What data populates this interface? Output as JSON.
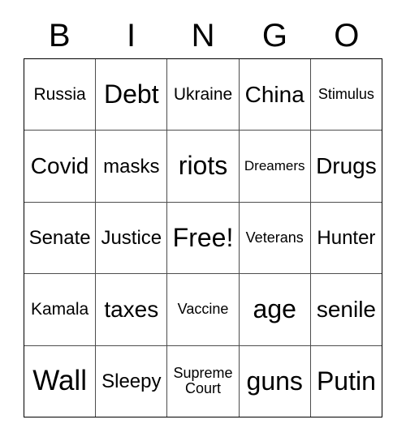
{
  "card": {
    "title": "BINGO",
    "header_letters": [
      "B",
      "I",
      "N",
      "G",
      "O"
    ],
    "colors": {
      "background": "#ffffff",
      "text": "#000000",
      "outer_border": "#000000",
      "inner_border": "#4d4d4d"
    },
    "rows": [
      [
        {
          "label": "Russia",
          "size": "md"
        },
        {
          "label": "Debt",
          "size": "xxl"
        },
        {
          "label": "Ukraine",
          "size": "md"
        },
        {
          "label": "China",
          "size": "xl"
        },
        {
          "label": "Stimulus",
          "size": "sm"
        }
      ],
      [
        {
          "label": "Covid",
          "size": "xl"
        },
        {
          "label": "masks",
          "size": "lg"
        },
        {
          "label": "riots",
          "size": "xxl"
        },
        {
          "label": "Dreamers",
          "size": "xs"
        },
        {
          "label": "Drugs",
          "size": "xl"
        }
      ],
      [
        {
          "label": "Senate",
          "size": "lg"
        },
        {
          "label": "Justice",
          "size": "lg"
        },
        {
          "label": "Free!",
          "size": "xxl"
        },
        {
          "label": "Veterans",
          "size": "sm"
        },
        {
          "label": "Hunter",
          "size": "lg"
        }
      ],
      [
        {
          "label": "Kamala",
          "size": "md"
        },
        {
          "label": "taxes",
          "size": "xl"
        },
        {
          "label": "Vaccine",
          "size": "sm"
        },
        {
          "label": "age",
          "size": "xxl"
        },
        {
          "label": "senile",
          "size": "xl"
        }
      ],
      [
        {
          "label": "Wall",
          "size": "xxxl"
        },
        {
          "label": "Sleepy",
          "size": "lg"
        },
        {
          "label": "Supreme\nCourt",
          "size": "sm"
        },
        {
          "label": "guns",
          "size": "xxl"
        },
        {
          "label": "Putin",
          "size": "xxl"
        }
      ]
    ]
  }
}
